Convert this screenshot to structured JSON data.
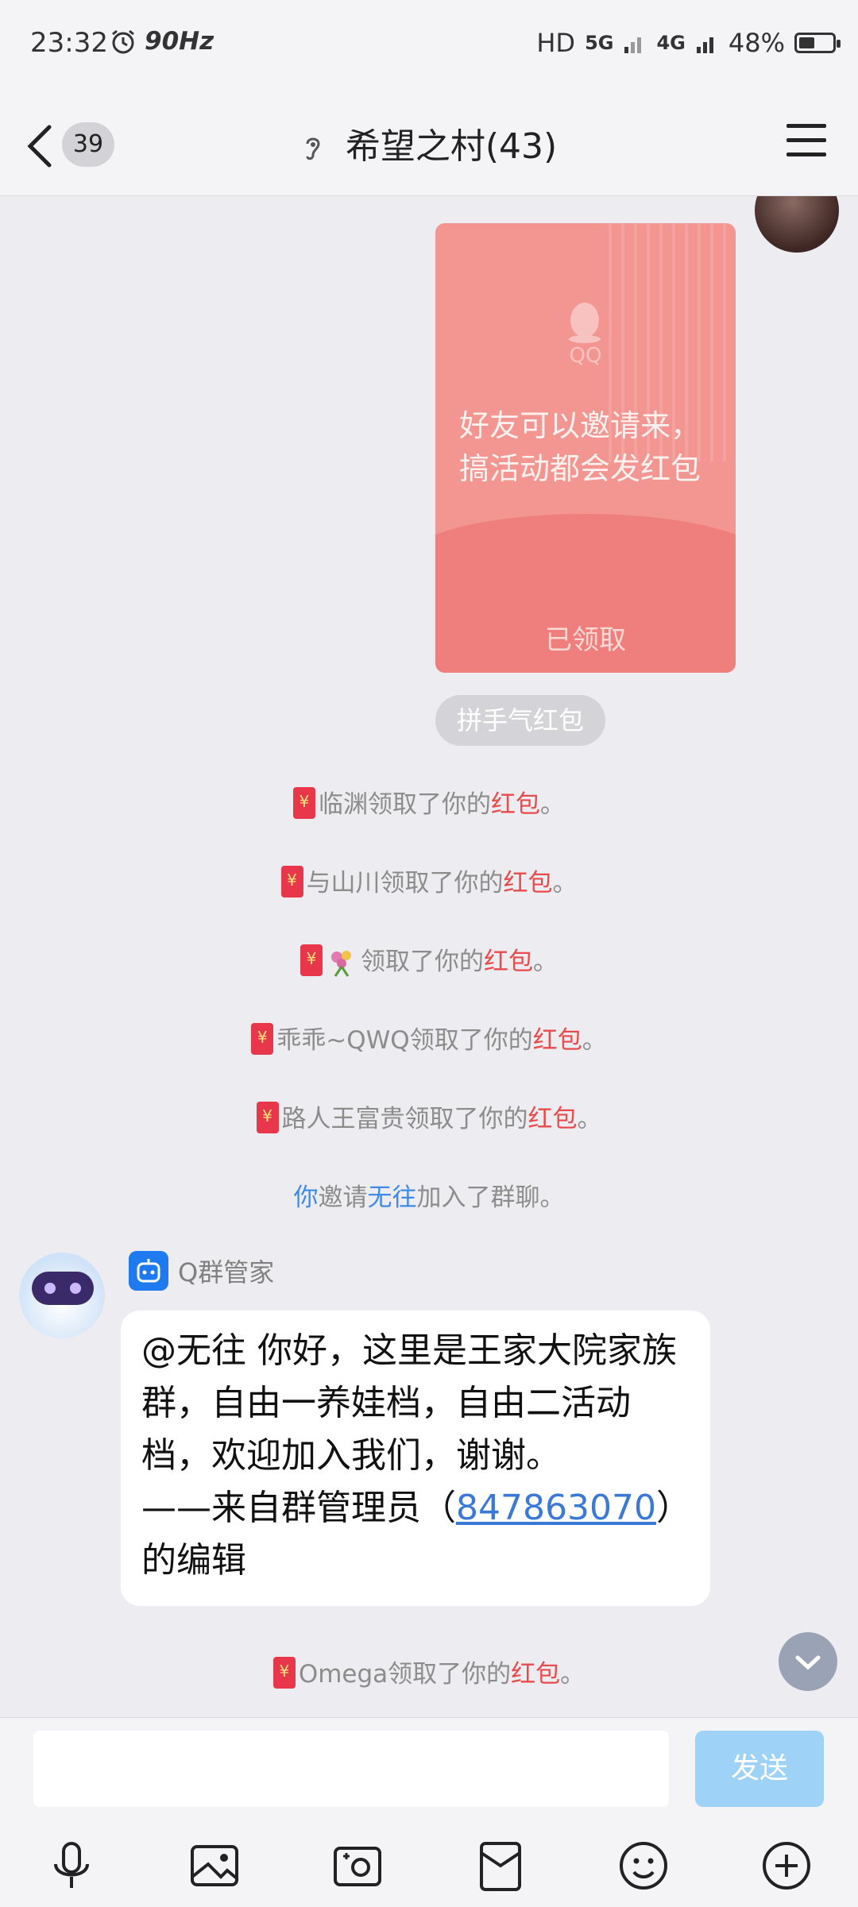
{
  "status_bar": {
    "time": "23:32",
    "refresh": "90Hz",
    "hd": "HD",
    "net1": "5G",
    "net2": "4G",
    "battery": "48%",
    "battery_level": 0.48
  },
  "header": {
    "unread_count": "39",
    "title": "希望之村(43)"
  },
  "red_packet": {
    "logo": "QQ",
    "message": "好友可以邀请来，搞活动都会发红包",
    "status": "已领取"
  },
  "packet_type": "拼手气红包",
  "system": [
    {
      "name": "临渊",
      "pre": "领取了你的",
      "link": "红包",
      "end": "。"
    },
    {
      "name": "与山川",
      "pre": "领取了你的",
      "link": "红包",
      "end": "。"
    },
    {
      "name": "",
      "pre": "领取了你的",
      "link": "红包",
      "end": "。"
    },
    {
      "name": "乖乖~QWQ",
      "pre": "领取了你的",
      "link": "红包",
      "end": "。"
    },
    {
      "name": "路人王富贵",
      "pre": "领取了你的",
      "link": "红包",
      "end": "。"
    },
    {
      "name": "Omega",
      "pre": "领取了你的",
      "link": "红包",
      "end": "。"
    }
  ],
  "invite": {
    "who": "你",
    "verb": "邀请",
    "target": "无往",
    "rest": "加入了群聊。"
  },
  "bot": {
    "name": "Q群管家",
    "message_main": "@无往 你好，这里是王家大院家族群，自由一养娃档，自由二活动档，欢迎加入我们，谢谢。",
    "message_prefix": "——来自群管理员（",
    "admin_id": "847863070",
    "message_suffix": "）的编辑"
  },
  "input": {
    "placeholder": "",
    "send_label": "发送"
  },
  "toolbar_icons": [
    "microphone-icon",
    "image-icon",
    "camera-icon",
    "red-packet-icon",
    "emoji-icon",
    "plus-icon"
  ],
  "colors": {
    "accent": "#3f8ae6",
    "red": "#e84b4b",
    "send": "#9fd2f7",
    "packet": "#f39590"
  }
}
